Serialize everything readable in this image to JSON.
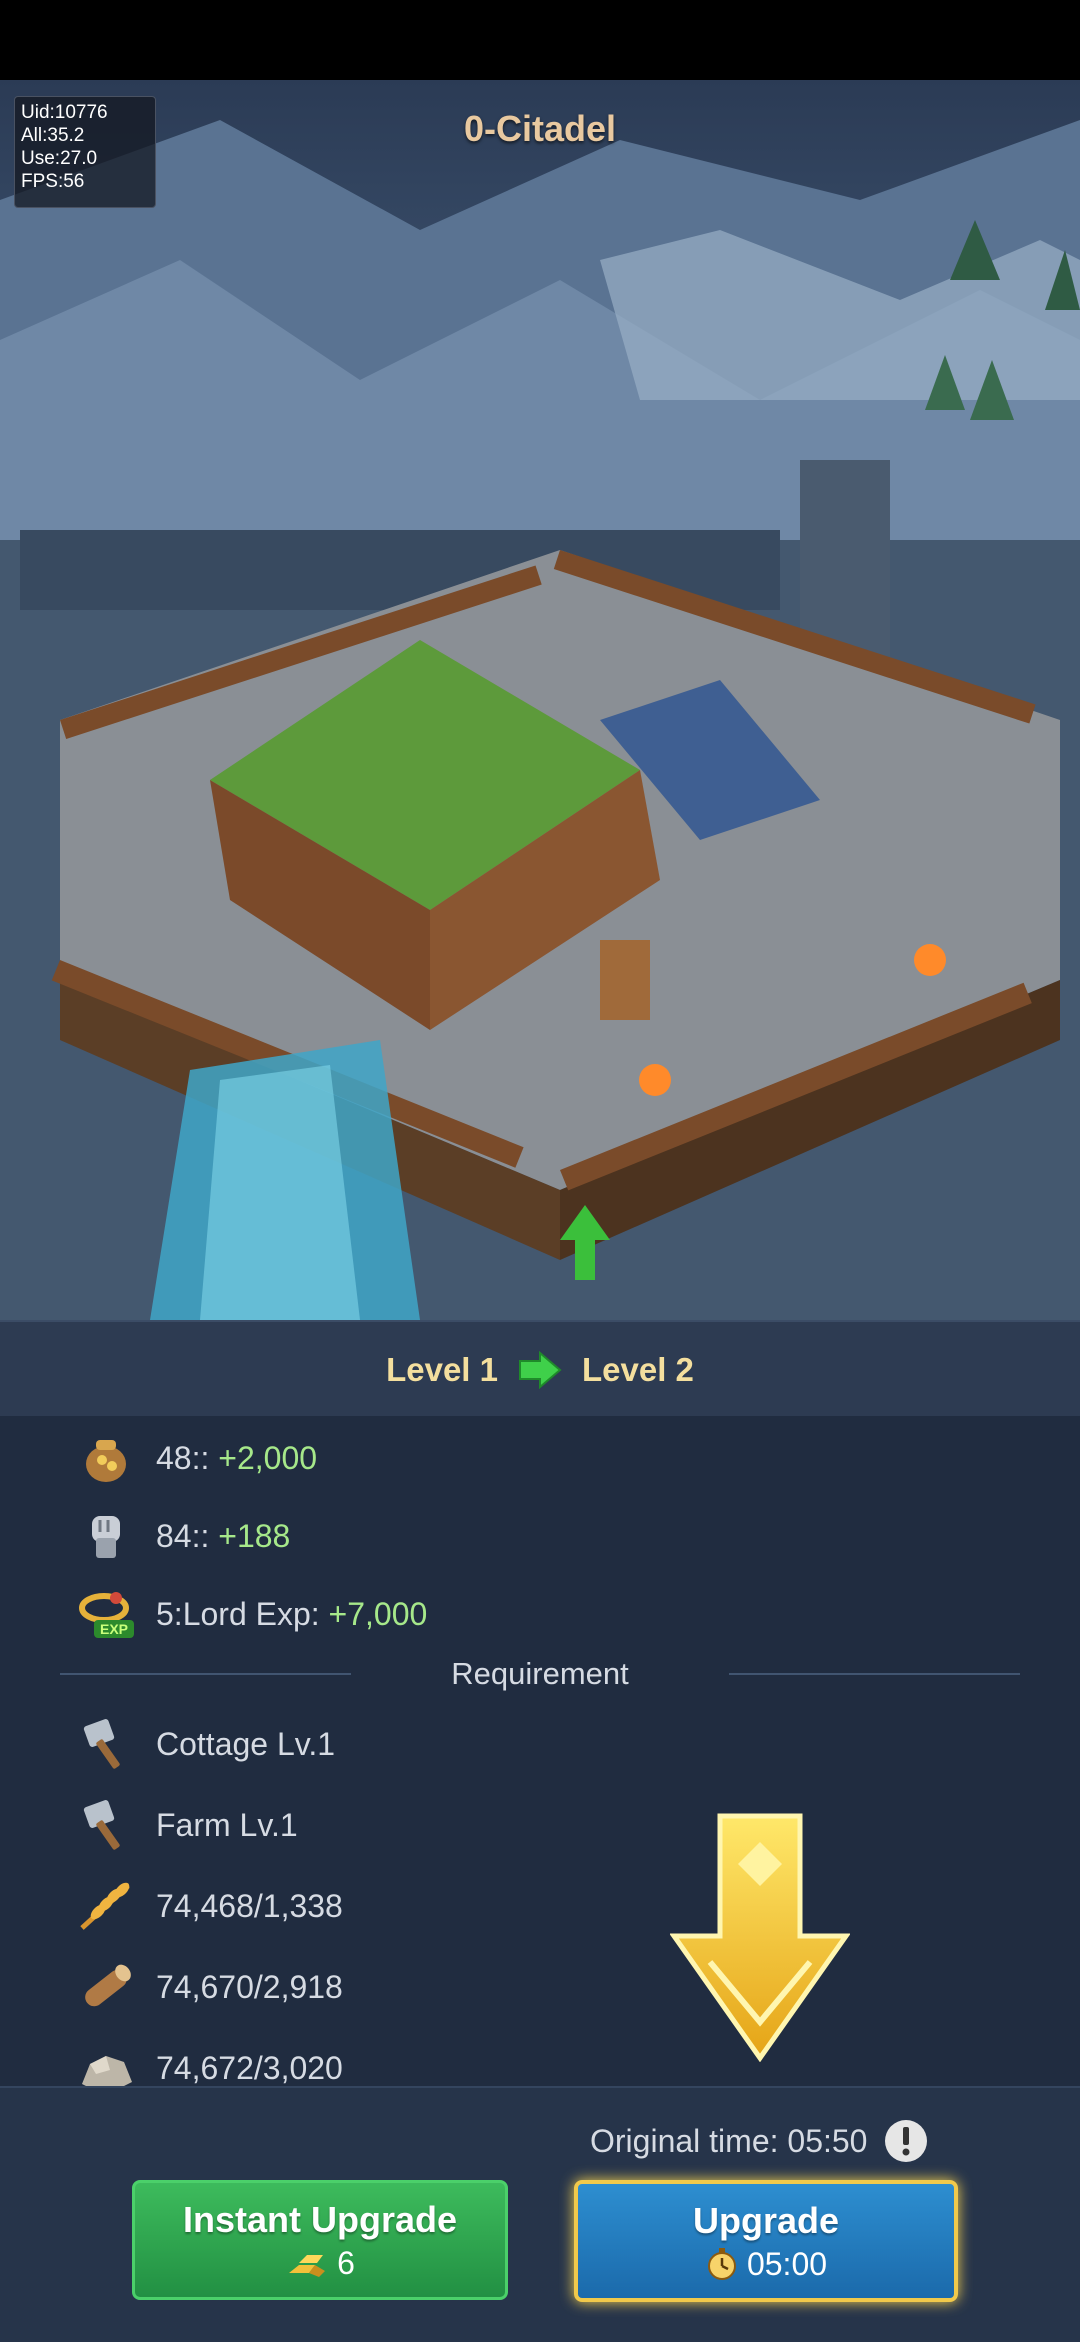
{
  "debug": {
    "uid": "Uid:10776",
    "all": "All:35.2",
    "use": "Use:27.0",
    "fps": "FPS:56"
  },
  "building": {
    "title": "0-Citadel"
  },
  "level": {
    "from": "Level 1",
    "to": "Level 2"
  },
  "rewards": [
    {
      "icon": "treasure-sack-icon",
      "label": "48:: ",
      "value": "+2,000"
    },
    {
      "icon": "fist-power-icon",
      "label": "84:: ",
      "value": "+188"
    },
    {
      "icon": "exp-ring-icon",
      "label": "5:Lord Exp: ",
      "value": "+7,000"
    }
  ],
  "requirement": {
    "title": "Requirement",
    "items": [
      {
        "icon": "hammer-icon",
        "text": "Cottage Lv.1"
      },
      {
        "icon": "hammer-icon",
        "text": "Farm Lv.1"
      },
      {
        "icon": "wheat-icon",
        "text": "74,468/1,338"
      },
      {
        "icon": "wood-log-icon",
        "text": "74,670/2,918"
      },
      {
        "icon": "stone-icon",
        "text": "74,672/3,020"
      }
    ]
  },
  "timing": {
    "original_label": "Original time: 05:50"
  },
  "buttons": {
    "instant": {
      "title": "Instant Upgrade",
      "cost": "6"
    },
    "upgrade": {
      "title": "Upgrade",
      "time": "05:00"
    }
  },
  "colors": {
    "panel": "#27344a",
    "green_value": "#a6e88a",
    "gold_title": "#e9c9a0",
    "level_text": "#f4df9e"
  }
}
